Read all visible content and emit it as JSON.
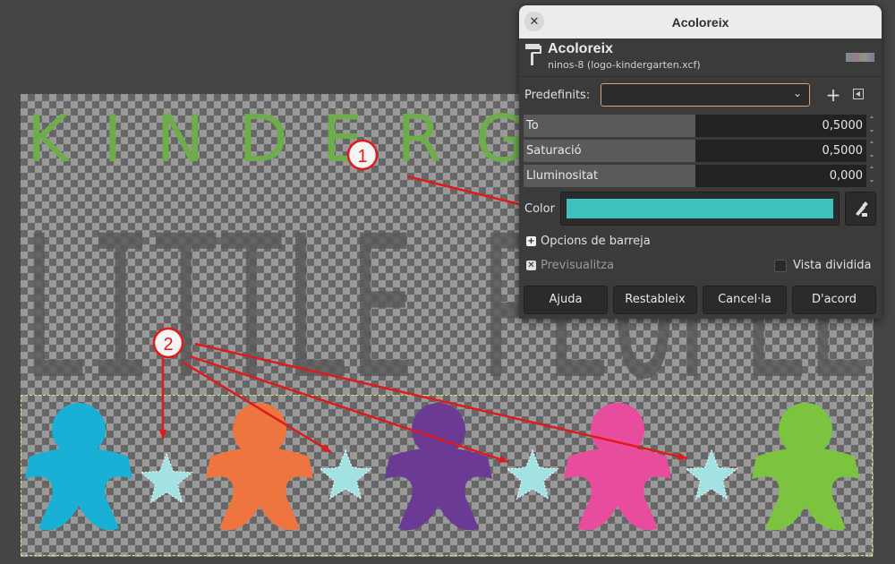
{
  "dialog": {
    "window_title": "Acoloreix",
    "close_icon": "close-icon",
    "header": {
      "title": "Acoloreix",
      "subtitle": "ninos-8 (logo-kindergarten.xcf)",
      "tool_icon": "paint-roller-icon"
    },
    "presets": {
      "label": "Predefinits:",
      "value": "",
      "add_icon": "plus-icon",
      "menu_icon": "menu-arrow-icon"
    },
    "sliders": [
      {
        "label": "To",
        "value": "0,5000",
        "fill": 0.5
      },
      {
        "label": "Saturació",
        "value": "0,5000",
        "fill": 0.5
      },
      {
        "label": "Lluminositat",
        "value": "0,000",
        "fill": 0.5
      }
    ],
    "color": {
      "label": "Color",
      "swatch": "#3fbfbe",
      "picker_icon": "color-picker-icon"
    },
    "blend_options": {
      "label": "Opcions de barreja",
      "icon": "expand-plus-icon"
    },
    "preview": {
      "label": "Previsualitza",
      "checked": true
    },
    "split_view": {
      "label": "Vista dividida",
      "checked": false
    },
    "buttons": {
      "help": "Ajuda",
      "reset": "Restableix",
      "cancel": "Cancel·la",
      "ok": "D'acord"
    }
  },
  "image": {
    "heading_text": "KINDERG",
    "subheading_text": "LITTLE PEOPLE",
    "figure_colors": [
      "#1ab0d6",
      "#ee7440",
      "#6a3a94",
      "#e84c9c",
      "#7cc440"
    ],
    "star_color": "#a2e2e2"
  },
  "annotations": {
    "marker_1": "1",
    "marker_2": "2",
    "arrow_color": "#e01a1a"
  }
}
